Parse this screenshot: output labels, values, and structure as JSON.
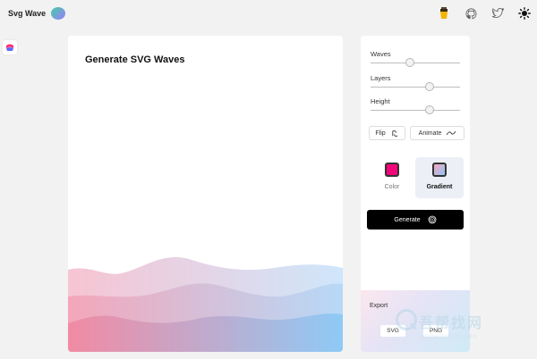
{
  "header": {
    "title": "Svg Wave",
    "icons": [
      "coffee-icon",
      "github-icon",
      "twitter-icon",
      "sun-icon"
    ]
  },
  "canvas": {
    "title": "Generate SVG Waves"
  },
  "controls": {
    "sliders": [
      {
        "label": "Waves",
        "value": 0.43
      },
      {
        "label": "Layers",
        "value": 0.65
      },
      {
        "label": "Height",
        "value": 0.65
      }
    ],
    "flip_label": "Flip",
    "animate_label": "Animate",
    "modes": [
      {
        "label": "Color",
        "selected": false,
        "swatch": "#f3067a"
      },
      {
        "label": "Gradient",
        "selected": true,
        "swatch_from": "#f8a6c0",
        "swatch_to": "#8fc6f5"
      }
    ],
    "generate_label": "Generate"
  },
  "export": {
    "title": "Export",
    "buttons": [
      "SVG",
      "PNG"
    ]
  },
  "watermark": {
    "text": "吾帮找网",
    "sub": "wubangzhao.com"
  },
  "colors": {
    "gradient_start": "#f48aa2",
    "gradient_end": "#8fc6f5",
    "accent": "#f3067a"
  }
}
